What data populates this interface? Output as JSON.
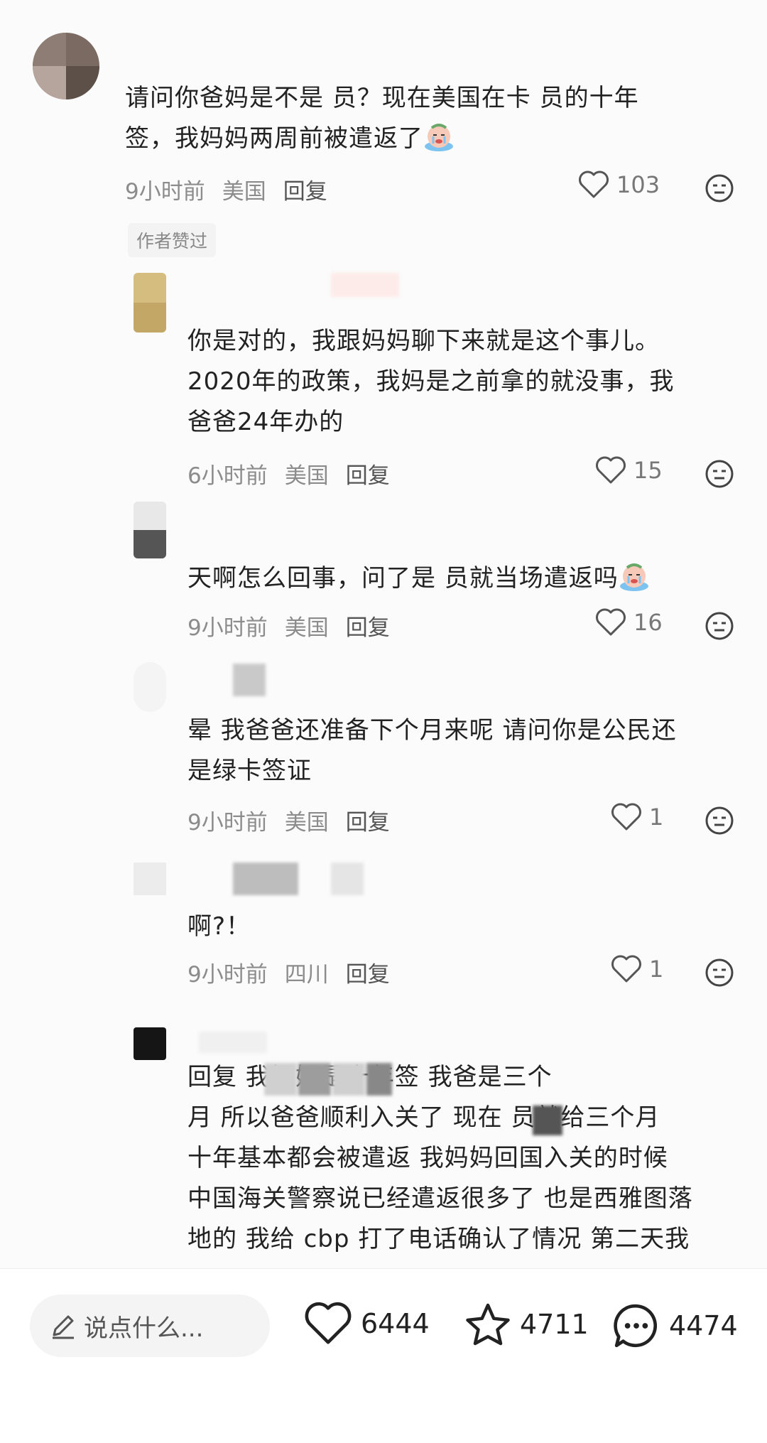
{
  "comments": [
    {
      "text_lines": [
        "请问你爸妈是不是 员？现在美国在卡 员的十年",
        "签，我妈妈两周前被遣返了"
      ],
      "time": "9小时前",
      "location": "美国",
      "reply": "回复",
      "likes": "103",
      "badge": "作者赞过"
    },
    {
      "text_lines": [
        "你是对的，我跟妈妈聊下来就是这个事儿。",
        "2020年的政策，我妈是之前拿的就没事，我",
        "爸爸24年办的"
      ],
      "time": "6小时前",
      "location": "美国",
      "reply": "回复",
      "likes": "15"
    },
    {
      "text_lines": [
        "天啊怎么回事，问了是 员就当场遣返吗"
      ],
      "time": "9小时前",
      "location": "美国",
      "reply": "回复",
      "likes": "16"
    },
    {
      "text_lines": [
        "晕 我爸爸还准备下个月来呢 请问你是公民还",
        "是绿卡签证"
      ],
      "time": "9小时前",
      "location": "美国",
      "reply": "回复",
      "likes": "1"
    },
    {
      "text_lines": [
        "啊?！"
      ],
      "time": "9小时前",
      "location": "四川",
      "reply": "回复",
      "likes": "1"
    },
    {
      "text_lines": [
        "回复           我妈妈是十年签 我爸是三个",
        "月 所以爸爸顺利入关了 现在   员就给三个月",
        "十年基本都会被遣返 我妈妈回国入关的时候",
        "中国海关警察说已经遣返很多了 也是西雅图落",
        "地的 我给 cbp 打了电话确认了情况 第二天我"
      ]
    }
  ],
  "bottom_bar": {
    "placeholder": "说点什么...",
    "likes": "6444",
    "favorites": "4711",
    "comments": "4474"
  },
  "colors": {
    "meta": "#8c8c8c",
    "text": "#222222",
    "background": "#fbfbfb"
  },
  "icons": [
    "heart-icon",
    "neutral-face-icon",
    "crying-emoji-icon",
    "pencil-icon",
    "star-icon",
    "chat-bubble-icon"
  ]
}
